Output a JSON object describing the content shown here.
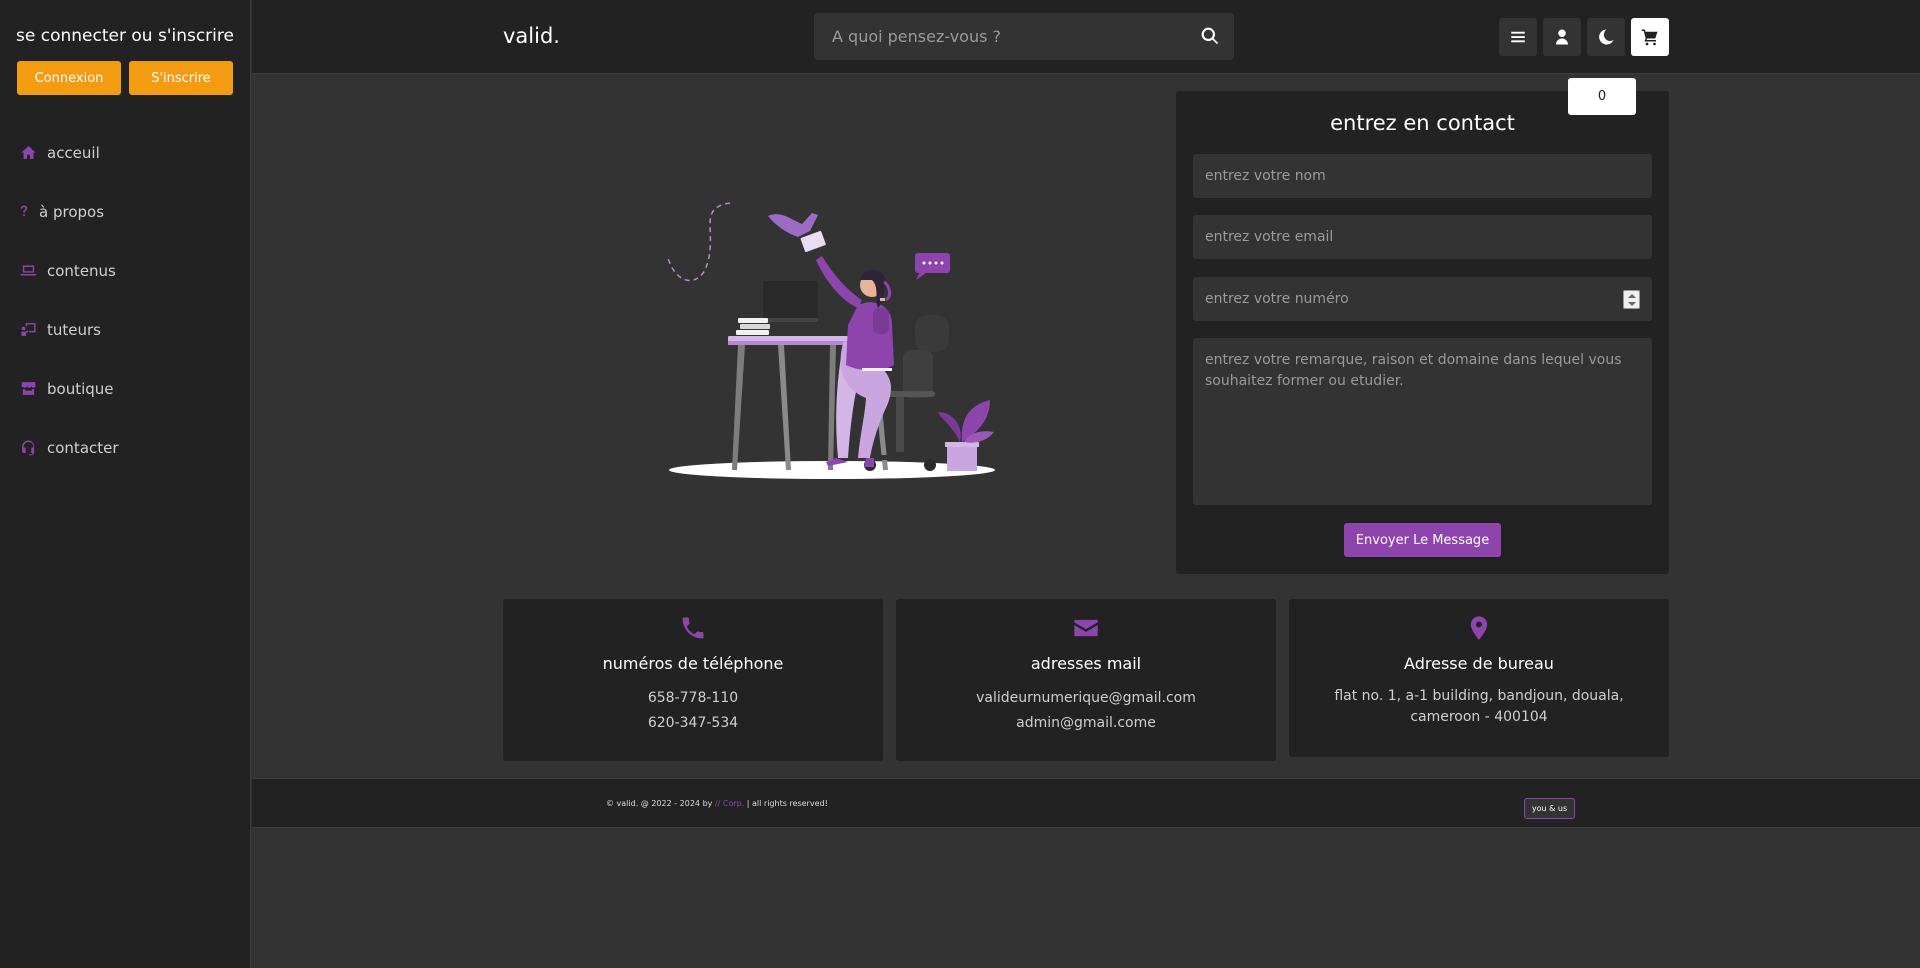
{
  "sidebar": {
    "title": "se connecter ou s'inscrire",
    "login_label": "Connexion",
    "signup_label": "S'inscrire",
    "items": [
      {
        "label": "acceuil",
        "icon": "home-icon"
      },
      {
        "label": "à propos",
        "icon": "question-icon"
      },
      {
        "label": "contenus",
        "icon": "laptop-icon"
      },
      {
        "label": "tuteurs",
        "icon": "chalkboard-teacher-icon"
      },
      {
        "label": "boutique",
        "icon": "store-icon"
      },
      {
        "label": "contacter",
        "icon": "headset-icon"
      }
    ]
  },
  "header": {
    "brand": "valid.",
    "search_placeholder": "A quoi pensez-vous ?",
    "cart_count": "0"
  },
  "contact_form": {
    "title": "entrez en contact",
    "name_placeholder": "entrez votre nom",
    "email_placeholder": "entrez votre email",
    "number_placeholder": "entrez votre numéro",
    "message_placeholder": "entrez votre remarque, raison et domaine dans lequel vous souhaitez former ou etudier.",
    "submit_label": "Envoyer Le Message"
  },
  "info_cards": {
    "phone": {
      "title": "numéros de téléphone",
      "lines": [
        "658-778-110",
        "620-347-534"
      ]
    },
    "email": {
      "title": "adresses mail",
      "lines": [
        "valideurnumerique@gmail.com",
        "admin@gmail.come"
      ]
    },
    "office": {
      "title": "Adresse de bureau",
      "address": "flat no. 1, a-1 building, bandjoun, douala, cameroon - 400104"
    }
  },
  "footer": {
    "copy_prefix": "© valid. @ 2022 -  2024 by ",
    "copy_accent": "// Corp.",
    "copy_suffix": " | all rights reserved!",
    "you_us_label": "you & us"
  },
  "colors": {
    "accent": "#8e44ad",
    "auth_button": "#f39c12",
    "panel": "#222222",
    "background": "#333333"
  }
}
